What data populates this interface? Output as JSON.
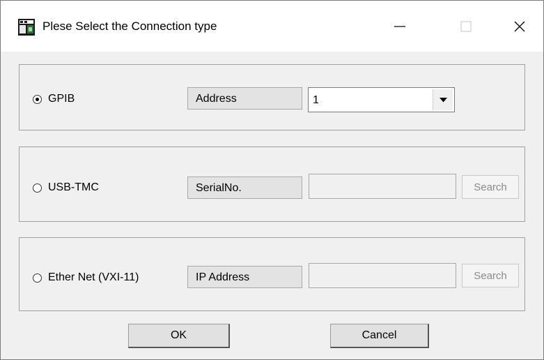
{
  "window": {
    "title": "Plese Select the Connection type",
    "controls": [
      "minimize-icon",
      "maximize-icon",
      "close-icon"
    ]
  },
  "groups": {
    "gpib": {
      "radio_label": "GPIB",
      "selected": true,
      "field_label": "Address",
      "address_value": "1"
    },
    "usb": {
      "radio_label": "USB-TMC",
      "selected": false,
      "field_label": "SerialNo.",
      "serial_value": "",
      "search_label": "Search"
    },
    "ether": {
      "radio_label": "Ether Net (VXI-11)",
      "selected": false,
      "field_label": "IP Address",
      "ip_value": "",
      "search_label": "Search"
    }
  },
  "buttons": {
    "ok_label": "OK",
    "cancel_label": "Cancel"
  }
}
